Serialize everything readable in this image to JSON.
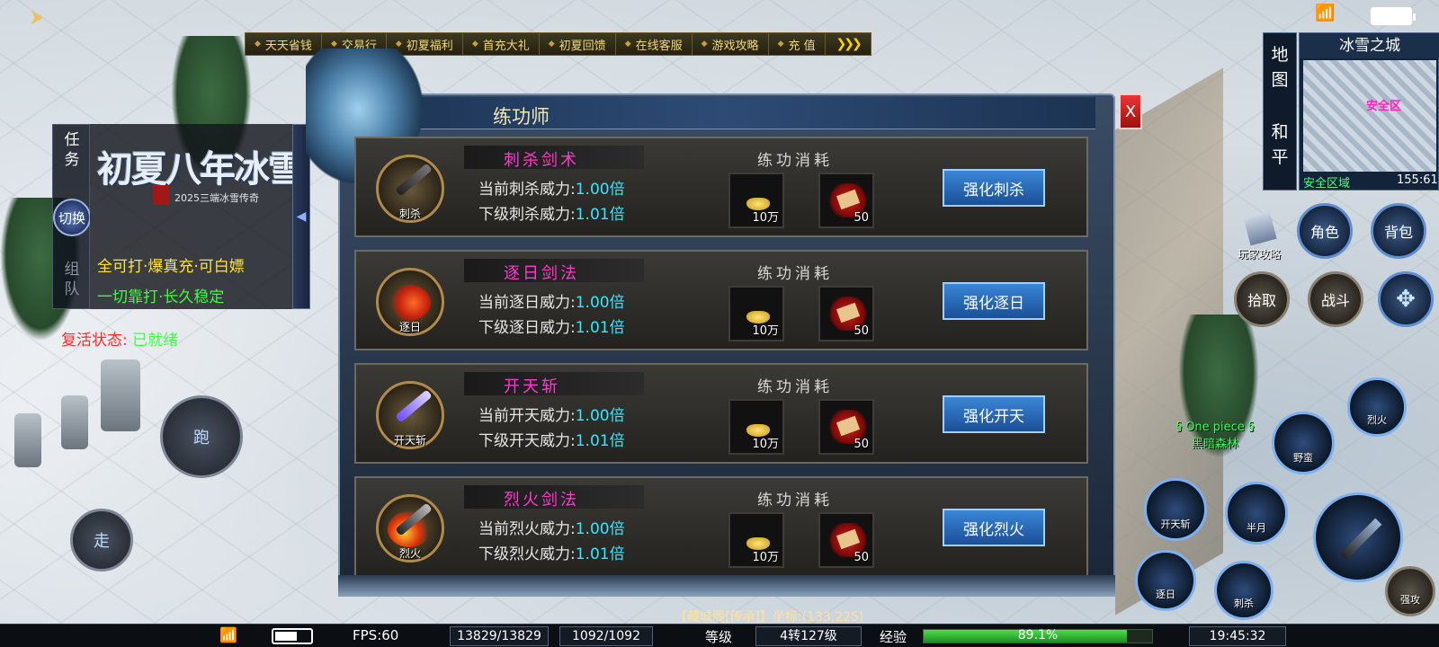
{
  "top": {
    "wifi": "📶"
  },
  "tabs": [
    "天天省钱",
    "交易行",
    "初夏福利",
    "首充大礼",
    "初夏回馈",
    "在线客服",
    "游戏攻略",
    "充 值"
  ],
  "tab_more": "❯❯❯",
  "left_panel": {
    "tab_task": "任\n务",
    "switch": "切换",
    "tab_team": "组\n队",
    "logo_main": "初夏八年冰雪",
    "logo_sub": "2025三端冰雪传奇",
    "line1": "全可打·爆真充·可白嫖",
    "line2": "一切靠打·长久稳定",
    "revive_label": "复活状态:",
    "revive_value": "已就绪"
  },
  "joystick": {
    "run": "跑",
    "walk": "走"
  },
  "dialog": {
    "title": "练功师",
    "close": "X",
    "cost_label": "练功消耗",
    "skills": [
      {
        "name": "刺杀剑术",
        "icon_caption": "刺杀",
        "current": "当前刺杀威力:",
        "current_val": "1.00倍",
        "next": "下级刺杀威力:",
        "next_val": "1.01倍",
        "gold": "10万",
        "scroll": "50",
        "button": "强化刺杀",
        "fx": "sword"
      },
      {
        "name": "逐日剑法",
        "icon_caption": "逐日",
        "current": "当前逐日威力:",
        "current_val": "1.00倍",
        "next": "下级逐日威力:",
        "next_val": "1.01倍",
        "gold": "10万",
        "scroll": "50",
        "button": "强化逐日",
        "fx": "fire-wave"
      },
      {
        "name": "开天斩",
        "icon_caption": "开天斩",
        "current": "当前开天威力:",
        "current_val": "1.00倍",
        "next": "下级开天威力:",
        "next_val": "1.01倍",
        "gold": "10万",
        "scroll": "50",
        "button": "强化开天",
        "fx": "purple-blade"
      },
      {
        "name": "烈火剑法",
        "icon_caption": "烈火",
        "current": "当前烈火威力:",
        "current_val": "1.00倍",
        "next": "下级烈火威力:",
        "next_val": "1.01倍",
        "gold": "10万",
        "scroll": "50",
        "button": "强化烈火",
        "fx": "flame-blade"
      }
    ]
  },
  "right_panel": {
    "map_tab": "地\n图",
    "peace_tab": "和\n平",
    "map_name": "冰雪之城",
    "safe_label": "安全区",
    "zone": "安全区域",
    "coord": "155:61",
    "guide": "玩家攻略",
    "role": "角色",
    "bag": "背包",
    "pickup": "拾取",
    "fight": "战斗",
    "npc1_line1": "§ One  piece §",
    "npc1_line2": "黑暗森林",
    "skill_btns": [
      "烈火",
      "野蛮",
      "开天斩",
      "半月",
      "逐日",
      "刺杀",
      "强攻"
    ]
  },
  "chat": "【藏城阁[传承]】坐标:(133,225)",
  "status": {
    "fps": "FPS:60",
    "hp": "13829/13829",
    "mp": "1092/1092",
    "level_label": "等级",
    "level": "4转127级",
    "exp_label": "经验",
    "exp": "89.1%",
    "exp_value": 0.891,
    "time": "19:45:32"
  },
  "colors": {
    "skill_name": "#ff3bcb",
    "value": "#39e6ff",
    "safe": "#ff20c0",
    "zone": "#4cff7a"
  }
}
